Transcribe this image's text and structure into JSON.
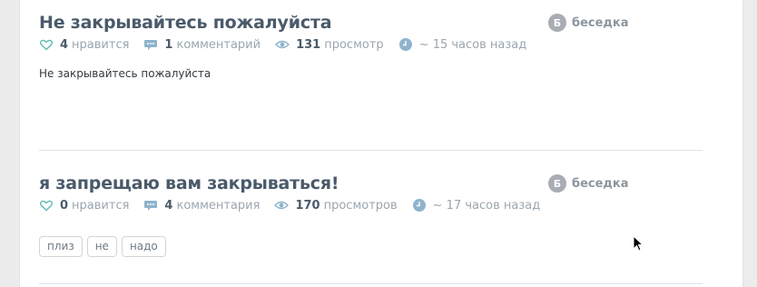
{
  "posts": [
    {
      "title": "Не закрывайтесь пожалуйста",
      "likes_count": "4",
      "likes_label": "нравится",
      "comments_count": "1",
      "comments_label": "комментарий",
      "views_count": "131",
      "views_label": "просмотр",
      "time": "~ 15 часов назад",
      "category_letter": "Б",
      "category": "беседка",
      "body": "Не закрывайтесь пожалуйста"
    },
    {
      "title": "я запрещаю вам закрываться!",
      "likes_count": "0",
      "likes_label": "нравится",
      "comments_count": "4",
      "comments_label": "комментария",
      "views_count": "170",
      "views_label": "просмотров",
      "time": "~ 17 часов назад",
      "category_letter": "Б",
      "category": "беседка",
      "tags": [
        "плиз",
        "не",
        "надо"
      ]
    }
  ],
  "colors": {
    "title": "#4a5a6a",
    "meta": "#9aa6b0",
    "icon_blue": "#8fb3cc",
    "like_teal": "#5fbcb3",
    "badge": "#a7adb3"
  },
  "icons": {
    "like": "heart-outline-icon",
    "comments": "speech-bubble-icon",
    "views": "eye-icon",
    "time": "clock-icon",
    "category": "category-letter-badge"
  }
}
